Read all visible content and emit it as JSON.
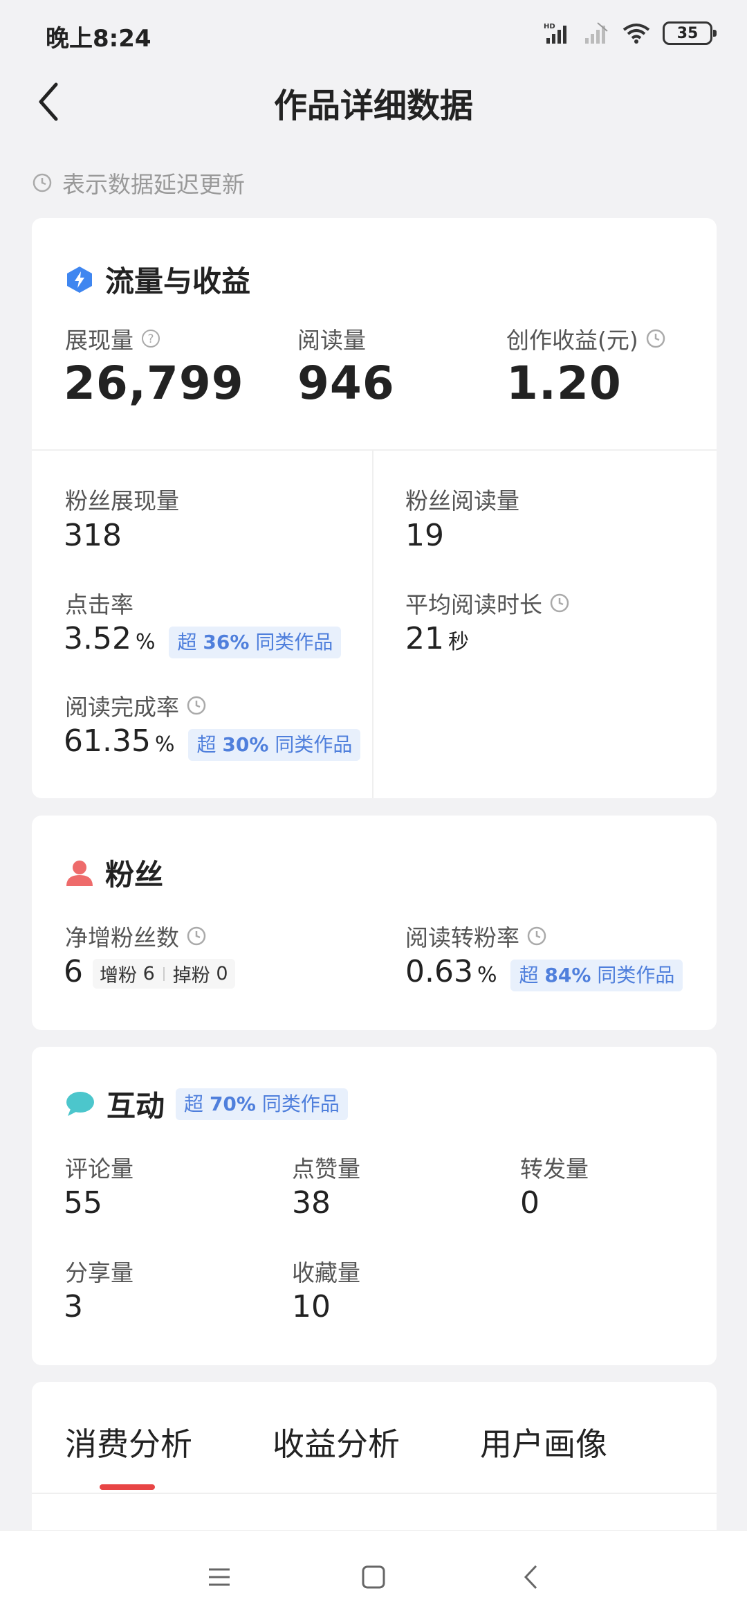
{
  "status_bar": {
    "time": "晚上8:24",
    "battery": "35"
  },
  "header": {
    "title": "作品详细数据"
  },
  "hint": {
    "text": "表示数据延迟更新"
  },
  "traffic": {
    "title": "流量与收益",
    "impressions": {
      "label": "展现量",
      "value": "26,799"
    },
    "reads": {
      "label": "阅读量",
      "value": "946"
    },
    "earnings": {
      "label": "创作收益(元)",
      "value": "1.20"
    },
    "fan_impressions": {
      "label": "粉丝展现量",
      "value": "318"
    },
    "fan_reads": {
      "label": "粉丝阅读量",
      "value": "19"
    },
    "ctr": {
      "label": "点击率",
      "value": "3.52",
      "unit": "%",
      "badge_prefix": "超",
      "badge_pct": "36%",
      "badge_suffix": "同类作品"
    },
    "avg_read_time": {
      "label": "平均阅读时长",
      "value": "21",
      "unit": "秒"
    },
    "completion": {
      "label": "阅读完成率",
      "value": "61.35",
      "unit": "%",
      "badge_prefix": "超",
      "badge_pct": "30%",
      "badge_suffix": "同类作品"
    }
  },
  "fans": {
    "title": "粉丝",
    "net_gain": {
      "label": "净增粉丝数",
      "value": "6",
      "gain_label": "增粉",
      "gain_value": "6",
      "loss_label": "掉粉",
      "loss_value": "0"
    },
    "conversion": {
      "label": "阅读转粉率",
      "value": "0.63",
      "unit": "%",
      "badge_prefix": "超",
      "badge_pct": "84%",
      "badge_suffix": "同类作品"
    }
  },
  "interaction": {
    "title": "互动",
    "badge_prefix": "超",
    "badge_pct": "70%",
    "badge_suffix": "同类作品",
    "comments": {
      "label": "评论量",
      "value": "55"
    },
    "likes": {
      "label": "点赞量",
      "value": "38"
    },
    "reposts": {
      "label": "转发量",
      "value": "0"
    },
    "shares": {
      "label": "分享量",
      "value": "3"
    },
    "favorites": {
      "label": "收藏量",
      "value": "10"
    }
  },
  "tabs": [
    "消费分析",
    "收益分析",
    "用户画像"
  ],
  "colors": {
    "accent_red": "#e84545",
    "badge_blue": "#4f7fdc",
    "badge_bg": "#e8f0fc",
    "traffic_icon": "#3f86f0",
    "fans_icon": "#ee6b6b",
    "interaction_icon": "#4cc6cc"
  }
}
